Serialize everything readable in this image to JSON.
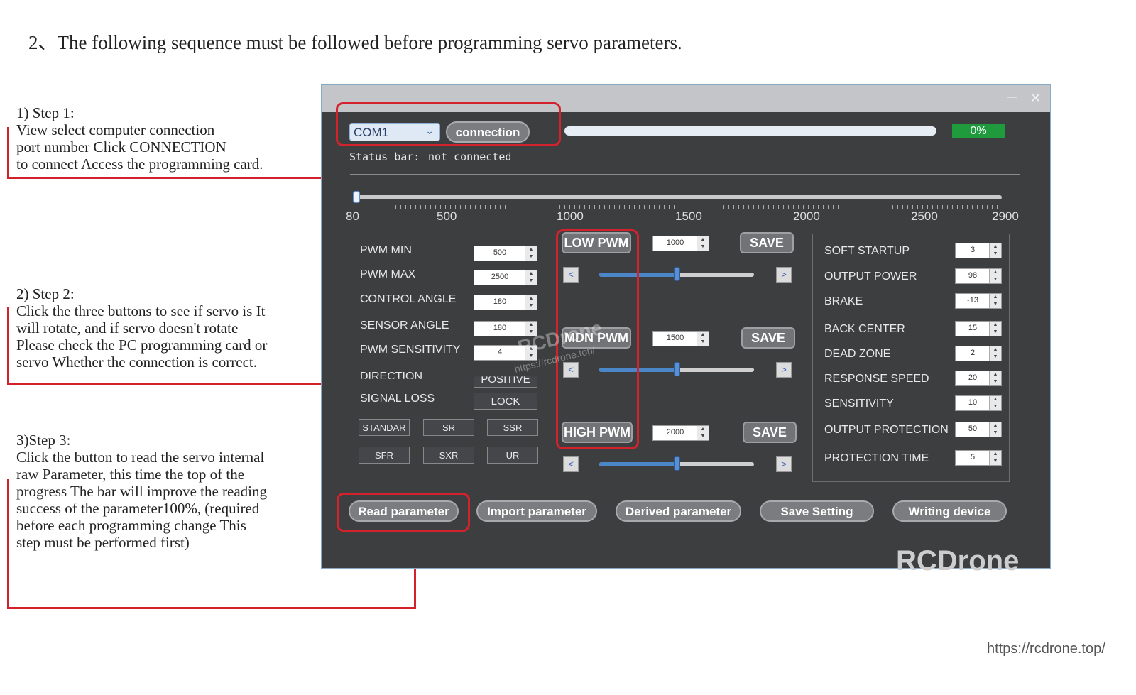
{
  "heading": "2、The following sequence must be followed before programming servo parameters.",
  "steps": [
    {
      "lines": [
        "1) Step 1:",
        "View select computer connection",
        "port number Click CONNECTION",
        "to connect Access the programming card."
      ]
    },
    {
      "lines": [
        "2) Step 2:",
        "Click the three buttons to see if servo is It",
        "will rotate, and if servo doesn't rotate",
        "Please check the PC programming card or",
        "servo Whether the connection is correct."
      ]
    },
    {
      "lines": [
        "3)Step 3:",
        "Click the button to read the servo internal",
        "raw Parameter, this time the top of the",
        "progress The bar will improve the reading",
        "success of the parameter100%, (required",
        "before each programming change This",
        "step must be performed first)"
      ]
    }
  ],
  "window": {
    "minimize": "─",
    "close": "✕",
    "port": "COM1",
    "connect_label": "connection",
    "progress_percent": 0,
    "progress_label": "0%",
    "status_label": "Status bar:",
    "status_value": "not connected",
    "range_ticks": [
      "80",
      "500",
      "1000",
      "1500",
      "2000",
      "2500",
      "2900"
    ],
    "range_min": 80,
    "range_max": 2900,
    "range_value": 80,
    "left_params": [
      {
        "label": "PWM MIN",
        "value": "500"
      },
      {
        "label": "PWM MAX",
        "value": "2500"
      },
      {
        "label": "CONTROL ANGLE",
        "value": "180"
      },
      {
        "label": "SENSOR ANGLE",
        "value": "180"
      },
      {
        "label": "PWM SENSITIVITY",
        "value": "4"
      }
    ],
    "direction_label": "DIRECTION",
    "direction_value": "POSITIVE",
    "signal_loss_label": "SIGNAL LOSS",
    "signal_loss_value": "LOCK",
    "modes": [
      "STANDAR",
      "SR",
      "SSR",
      "SFR",
      "SXR",
      "UR"
    ],
    "pwm_buttons": [
      {
        "label": "LOW PWM",
        "value": "1000",
        "save": "SAVE",
        "slider_fraction": 0.5
      },
      {
        "label": "MDN PWM",
        "value": "1500",
        "save": "SAVE",
        "slider_fraction": 0.5
      },
      {
        "label": "HIGH PWM",
        "value": "2000",
        "save": "SAVE",
        "slider_fraction": 0.5
      }
    ],
    "prev": "<",
    "next": ">",
    "right_params": [
      {
        "label": "SOFT STARTUP",
        "value": "3"
      },
      {
        "label": "OUTPUT POWER",
        "value": "98"
      },
      {
        "label": "BRAKE",
        "value": "-13"
      },
      {
        "label": "BACK CENTER",
        "value": "15"
      },
      {
        "label": "DEAD ZONE",
        "value": "2"
      },
      {
        "label": "RESPONSE SPEED",
        "value": "20"
      },
      {
        "label": "SENSITIVITY",
        "value": "10"
      },
      {
        "label": "OUTPUT PROTECTION",
        "value": "50"
      },
      {
        "label": "PROTECTION TIME",
        "value": "5"
      }
    ],
    "actions": [
      "Read parameter",
      "Import parameter",
      "Derived parameter",
      "Save Setting",
      "Writing device"
    ]
  },
  "watermarks": {
    "center": "RCDrone",
    "center_url": "https://rcdrone.top/",
    "corner": "RCDrone",
    "footer_url": "https://rcdrone.top/"
  },
  "colors": {
    "annotation_red": "#d3222b",
    "progress_green": "#1f9a3c",
    "slider_blue": "#4a86c8"
  }
}
